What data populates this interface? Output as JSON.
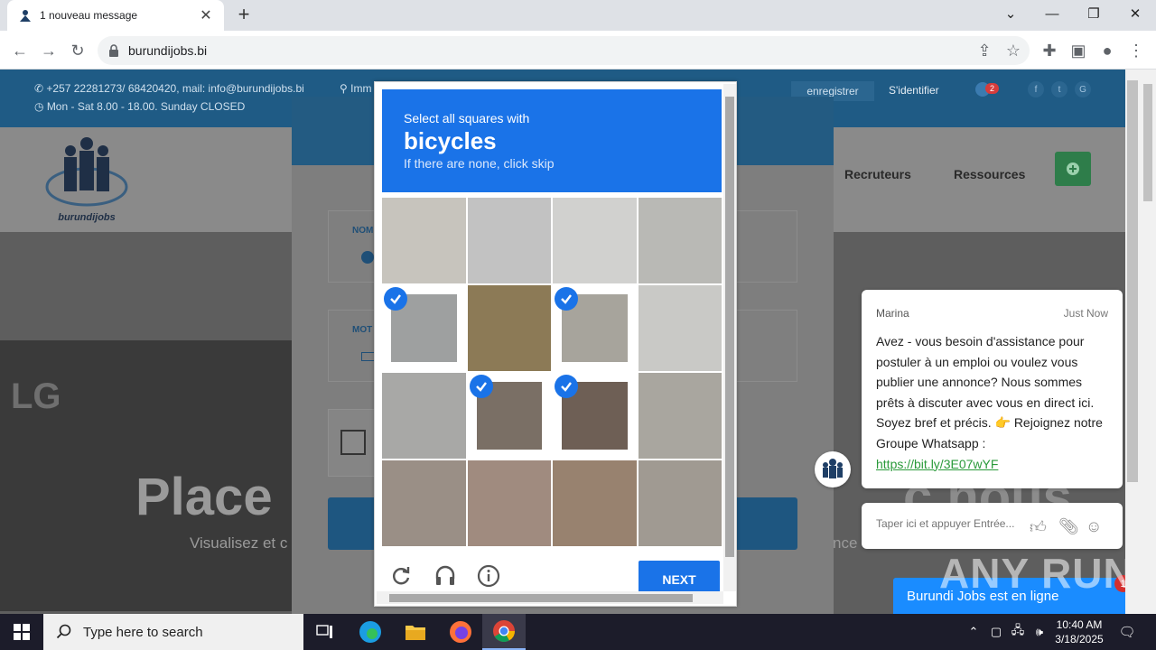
{
  "browser": {
    "tab_title": "1 nouveau message",
    "url": "burundijobs.bi"
  },
  "site": {
    "phone_line": "+257 22281273/ 68420420, mail: info@burundijobs.bi",
    "hours_line": "Mon - Sat 8.00 - 18.00. Sunday CLOSED",
    "location_text": "Imm",
    "register_label": "enregistrer",
    "login_label": "S'identifier",
    "cart_count": "2",
    "logo_text": "burundijobs",
    "nav": [
      "Recruteurs",
      "Ressources"
    ],
    "hero_title_left": "Place",
    "hero_title_right": "c nous",
    "hero_sub_left": "Visualisez et c",
    "hero_sub_right": "nce",
    "lg_text": "LG",
    "field1_label": "NOM",
    "field2_label": "MOT"
  },
  "captcha": {
    "instruction": "Select all squares with",
    "target": "bicycles",
    "hint": "If there are none, click skip",
    "next_label": "NEXT",
    "selected_tiles": [
      4,
      6,
      9,
      10
    ]
  },
  "chat": {
    "agent_name": "Marina",
    "time": "Just Now",
    "message": "Avez - vous besoin d'assistance pour postuler à un emploi ou voulez vous publier une annonce? Nous sommes prêts à discuter avec vous en direct ici. Soyez bref et précis. 👉 Rejoignez notre Groupe Whatsapp :",
    "link": "https://bit.ly/3E07wYF",
    "input_placeholder": "Taper ici et appuyer Entrée...",
    "bar_label": "Burundi Jobs est en ligne",
    "bar_badge": "1"
  },
  "watermark": "ANY RUN",
  "taskbar": {
    "search_placeholder": "Type here to search",
    "time": "10:40 AM",
    "date": "3/18/2025"
  },
  "colors": {
    "captcha_blue": "#1a73e8",
    "site_dark_blue": "#1f5b85",
    "chat_link_green": "#2a9a3a"
  }
}
